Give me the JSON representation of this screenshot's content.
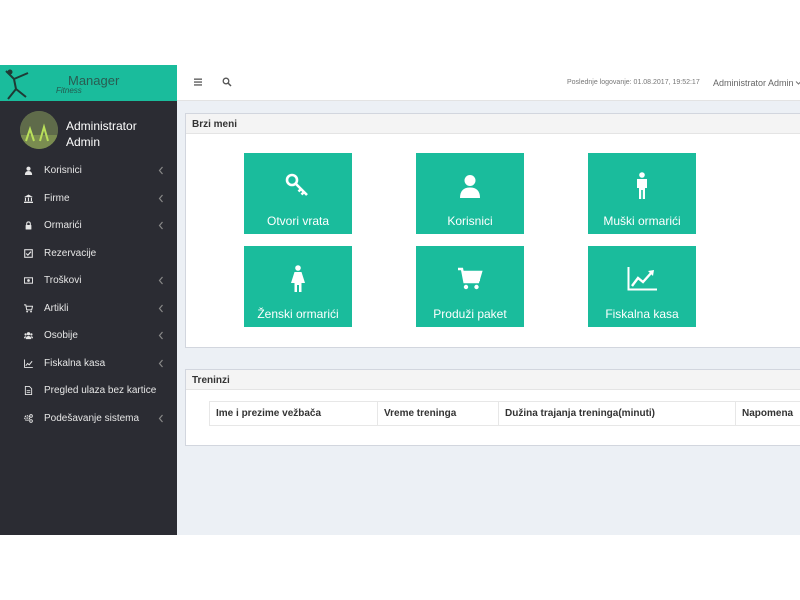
{
  "brand": {
    "main": "Manager",
    "sub": "Fitness",
    "accent_color": "#1abc9c"
  },
  "user": {
    "name": "Administrator Admin"
  },
  "sidebar": {
    "items": [
      {
        "label": "Korisnici",
        "icon": "user-icon",
        "has_submenu": true
      },
      {
        "label": "Firme",
        "icon": "bank-icon",
        "has_submenu": true
      },
      {
        "label": "Ormarići",
        "icon": "lock-icon",
        "has_submenu": true
      },
      {
        "label": "Rezervacije",
        "icon": "check-square-icon",
        "has_submenu": false
      },
      {
        "label": "Troškovi",
        "icon": "money-icon",
        "has_submenu": true
      },
      {
        "label": "Artikli",
        "icon": "cart-icon",
        "has_submenu": true
      },
      {
        "label": "Osobije",
        "icon": "users-icon",
        "has_submenu": true
      },
      {
        "label": "Fiskalna kasa",
        "icon": "line-chart-icon",
        "has_submenu": true
      },
      {
        "label": "Pregled ulaza bez kartice",
        "icon": "file-icon",
        "has_submenu": false
      },
      {
        "label": "Podešavanje sistema",
        "icon": "cogs-icon",
        "has_submenu": true
      }
    ]
  },
  "topbar": {
    "last_login": "Poslednje logovanje: 01.08.2017, 19:52:17",
    "user_menu": "Administrator Admin"
  },
  "quick_menu": {
    "title": "Brzi meni",
    "tiles": [
      {
        "label": "Otvori vrata",
        "icon": "key-icon"
      },
      {
        "label": "Korisnici",
        "icon": "user-icon"
      },
      {
        "label": "Muški ormarići",
        "icon": "male-icon"
      },
      {
        "label": "Ženski ormarići",
        "icon": "female-icon"
      },
      {
        "label": "Produži paket",
        "icon": "cart-icon"
      },
      {
        "label": "Fiskalna kasa",
        "icon": "line-chart-icon"
      }
    ]
  },
  "trainings": {
    "title": "Treninzi",
    "columns": [
      "Ime i prezime vežbača",
      "Vreme treninga",
      "Dužina trajanja treninga(minuti)",
      "Napomena"
    ]
  }
}
